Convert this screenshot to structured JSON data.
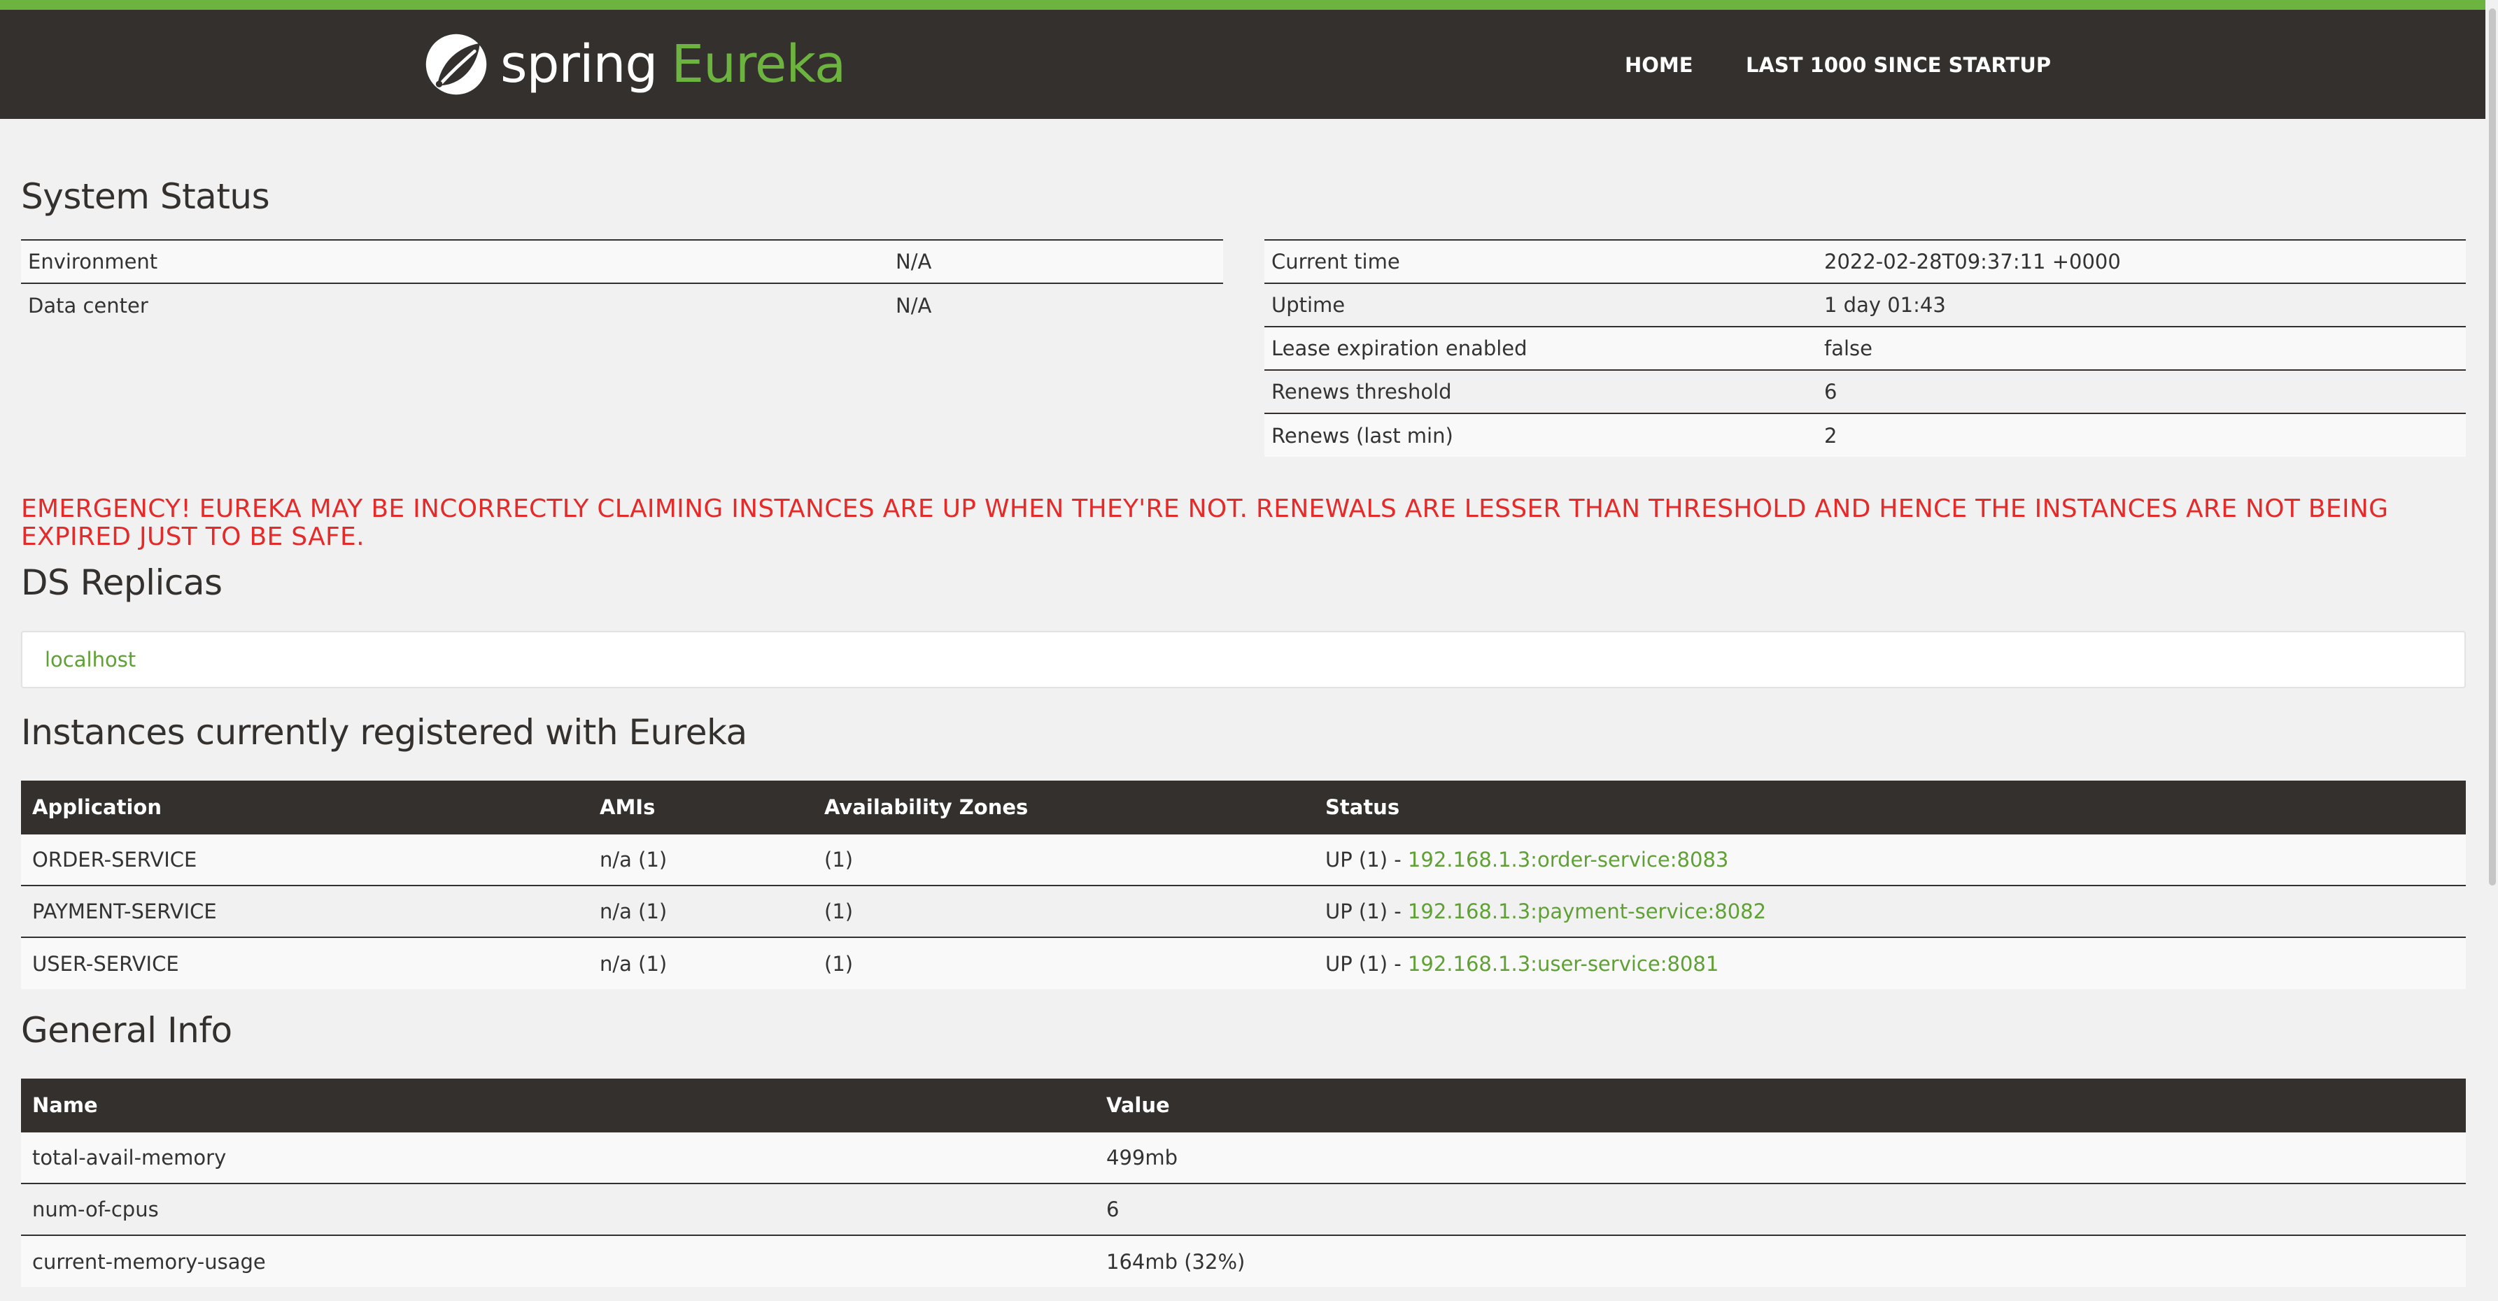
{
  "nav": {
    "brand_spring": "spring",
    "brand_eureka": "Eureka",
    "home": "HOME",
    "last1000": "LAST 1000 SINCE STARTUP"
  },
  "system_status": {
    "title": "System Status",
    "left": [
      {
        "label": "Environment",
        "value": "N/A"
      },
      {
        "label": "Data center",
        "value": "N/A"
      }
    ],
    "right": [
      {
        "label": "Current time",
        "value": "2022-02-28T09:37:11 +0000"
      },
      {
        "label": "Uptime",
        "value": "1 day 01:43"
      },
      {
        "label": "Lease expiration enabled",
        "value": "false"
      },
      {
        "label": "Renews threshold",
        "value": "6"
      },
      {
        "label": "Renews (last min)",
        "value": "2"
      }
    ]
  },
  "emergency": "EMERGENCY! EUREKA MAY BE INCORRECTLY CLAIMING INSTANCES ARE UP WHEN THEY'RE NOT. RENEWALS ARE LESSER THAN THRESHOLD AND HENCE THE INSTANCES ARE NOT BEING EXPIRED JUST TO BE SAFE.",
  "ds_replicas": {
    "title": "DS Replicas",
    "items": [
      "localhost"
    ]
  },
  "instances": {
    "title": "Instances currently registered with Eureka",
    "headers": [
      "Application",
      "AMIs",
      "Availability Zones",
      "Status"
    ],
    "rows": [
      {
        "app": "ORDER-SERVICE",
        "amis": "n/a (1)",
        "zones": "(1)",
        "status": "UP (1) - ",
        "link": "192.168.1.3:order-service:8083"
      },
      {
        "app": "PAYMENT-SERVICE",
        "amis": "n/a (1)",
        "zones": "(1)",
        "status": "UP (1) - ",
        "link": "192.168.1.3:payment-service:8082"
      },
      {
        "app": "USER-SERVICE",
        "amis": "n/a (1)",
        "zones": "(1)",
        "status": "UP (1) - ",
        "link": "192.168.1.3:user-service:8081"
      }
    ]
  },
  "general_info": {
    "title": "General Info",
    "headers": [
      "Name",
      "Value"
    ],
    "rows": [
      {
        "name": "total-avail-memory",
        "value": "499mb"
      },
      {
        "name": "num-of-cpus",
        "value": "6"
      },
      {
        "name": "current-memory-usage",
        "value": "164mb (32%)"
      }
    ]
  },
  "colors": {
    "accent_green": "#6db33f",
    "navbar_bg": "#34302d",
    "emergency_red": "#e52a2a"
  }
}
